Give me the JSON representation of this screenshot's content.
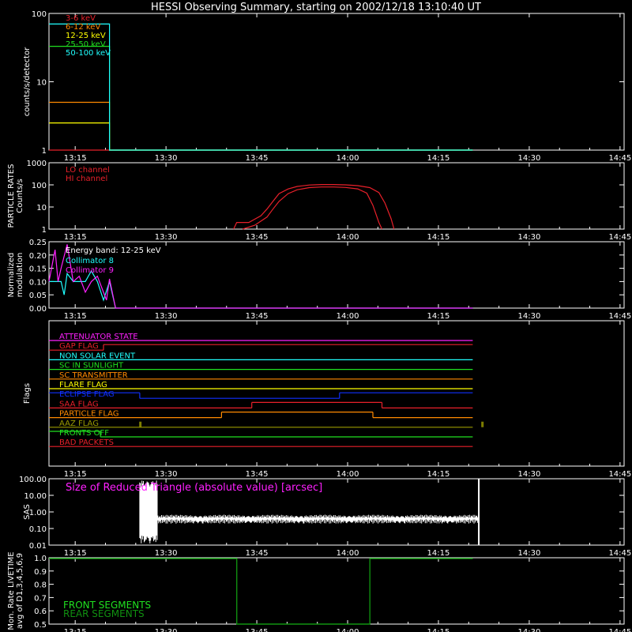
{
  "title": "HESSI Observing Summary, starting on 2002/12/18 13:10:40 UT",
  "colors": {
    "background": "#000000",
    "axes": "#ffffff",
    "red": "#e8202a",
    "orange": "#ff8a00",
    "yellow": "#ffff00",
    "green": "#20e020",
    "cyan": "#20ffff",
    "magenta": "#ff20ff",
    "blue": "#1030ff",
    "olive": "#9a9a00",
    "darkgreen": "#109010",
    "white": "#ffffff"
  },
  "time_ticks": [
    "13:15",
    "13:30",
    "13:45",
    "14:00",
    "14:15",
    "14:30",
    "14:45"
  ],
  "chart_data": [
    {
      "id": "count-rates",
      "type": "line",
      "scale": "log",
      "ylabel": "counts/s/detector",
      "yticks": [
        "1",
        "10",
        "100"
      ],
      "ylim": [
        1,
        100
      ],
      "xlim_min": [
        0,
        70
      ],
      "series": [
        {
          "name": "3-6 keV",
          "color": "red",
          "points": [
            [
              0,
              1
            ],
            [
              70,
              1
            ]
          ]
        },
        {
          "name": "6-12 keV",
          "color": "orange",
          "points": [
            [
              0,
              5
            ],
            [
              10,
              5
            ],
            [
              10,
              1
            ],
            [
              70,
              1
            ]
          ]
        },
        {
          "name": "12-25 keV",
          "color": "yellow",
          "points": [
            [
              0,
              2.5
            ],
            [
              10,
              2.5
            ],
            [
              10,
              1
            ],
            [
              70,
              1
            ]
          ]
        },
        {
          "name": "25-50 keV",
          "color": "green",
          "points": [
            [
              0,
              33
            ],
            [
              10,
              33
            ],
            [
              10,
              1
            ],
            [
              70,
              1
            ]
          ]
        },
        {
          "name": "50-100 keV",
          "color": "cyan",
          "points": [
            [
              0,
              70
            ],
            [
              10,
              70
            ],
            [
              10,
              1
            ],
            [
              70,
              1
            ]
          ]
        }
      ]
    },
    {
      "id": "particle-rates",
      "type": "line",
      "scale": "log",
      "ylabel": "PARTICLE RATES",
      "ylabel2": "Counts/s",
      "yticks": [
        "1",
        "10",
        "100",
        "1000"
      ],
      "ylim": [
        1,
        1000
      ],
      "series": [
        {
          "name": "LO channel",
          "color": "red",
          "points": [
            [
              30.5,
              1
            ],
            [
              31,
              2
            ],
            [
              33,
              2
            ],
            [
              35,
              4
            ],
            [
              36,
              8
            ],
            [
              37,
              18
            ],
            [
              38,
              40
            ],
            [
              39.5,
              65
            ],
            [
              41,
              85
            ],
            [
              43,
              98
            ],
            [
              45,
              103
            ],
            [
              47,
              103
            ],
            [
              49,
              100
            ],
            [
              51,
              92
            ],
            [
              53,
              75
            ],
            [
              54.5,
              45
            ],
            [
              55.5,
              15
            ],
            [
              56.5,
              3
            ],
            [
              57,
              1
            ]
          ]
        },
        {
          "name": "HI channel",
          "color": "red",
          "points": [
            [
              32,
              1
            ],
            [
              34,
              1.5
            ],
            [
              36,
              3.5
            ],
            [
              37,
              8
            ],
            [
              38,
              18
            ],
            [
              39.5,
              40
            ],
            [
              41,
              60
            ],
            [
              43,
              75
            ],
            [
              45,
              80
            ],
            [
              47,
              80
            ],
            [
              49,
              76
            ],
            [
              51,
              66
            ],
            [
              52.5,
              42
            ],
            [
              53.5,
              12
            ],
            [
              54.5,
              2
            ],
            [
              55,
              1
            ]
          ]
        }
      ]
    },
    {
      "id": "modulation",
      "type": "line",
      "ylabel": "Normalized",
      "ylabel2": "modulation",
      "yticks": [
        "0.00",
        "0.05",
        "0.10",
        "0.15",
        "0.20",
        "0.25"
      ],
      "ylim": [
        0,
        0.25
      ],
      "legend_title": "Energy band: 12-25 keV",
      "series": [
        {
          "name": "Collimator 8",
          "color": "cyan",
          "points": [
            [
              0,
              0.1
            ],
            [
              2,
              0.1
            ],
            [
              2.5,
              0.05
            ],
            [
              3,
              0.13
            ],
            [
              4,
              0.1
            ],
            [
              6,
              0.1
            ],
            [
              7,
              0.14
            ],
            [
              8,
              0.1
            ],
            [
              9,
              0.03
            ],
            [
              10,
              0.1
            ],
            [
              11,
              0.0
            ],
            [
              70,
              0.0
            ]
          ]
        },
        {
          "name": "Collimator 9",
          "color": "magenta",
          "points": [
            [
              0,
              0.1
            ],
            [
              1,
              0.22
            ],
            [
              1.5,
              0.1
            ],
            [
              2,
              0.15
            ],
            [
              3,
              0.24
            ],
            [
              4,
              0.1
            ],
            [
              5,
              0.12
            ],
            [
              6,
              0.06
            ],
            [
              7,
              0.1
            ],
            [
              8,
              0.12
            ],
            [
              9.5,
              0.03
            ],
            [
              10,
              0.11
            ],
            [
              11,
              0.0
            ],
            [
              70,
              0.0
            ]
          ]
        }
      ]
    },
    {
      "id": "flags",
      "type": "line",
      "ylabel": "Flags",
      "series": [
        {
          "name": "ATTENUATOR STATE",
          "color": "magenta",
          "segments": [
            [
              0,
              70,
              0
            ]
          ]
        },
        {
          "name": "GAP FLAG",
          "color": "red",
          "segments": [
            [
              0,
              9,
              0
            ],
            [
              9,
              70,
              1
            ]
          ]
        },
        {
          "name": "NON SOLAR EVENT",
          "color": "cyan",
          "segments": [
            [
              0,
              70,
              0
            ]
          ]
        },
        {
          "name": "SC IN SUNLIGHT",
          "color": "green",
          "segments": [
            [
              0,
              70,
              0
            ]
          ]
        },
        {
          "name": "SC TRANSMITTER",
          "color": "orange",
          "segments": [
            [
              0,
              70,
              0
            ]
          ]
        },
        {
          "name": "FLARE FLAG",
          "color": "yellow",
          "segments": [
            [
              0,
              70,
              0
            ]
          ]
        },
        {
          "name": "ECLIPSE FLAG",
          "color": "blue",
          "segments": [
            [
              0,
              15,
              1
            ],
            [
              15,
              48,
              0
            ],
            [
              48,
              70,
              1
            ]
          ]
        },
        {
          "name": "SAA FLAG",
          "color": "red",
          "segments": [
            [
              0,
              33.5,
              0
            ],
            [
              33.5,
              55,
              1
            ],
            [
              55,
              70,
              0
            ]
          ]
        },
        {
          "name": "PARTICLE FLAG",
          "color": "orange",
          "segments": [
            [
              0,
              28.5,
              0
            ],
            [
              28.5,
              53.5,
              1
            ],
            [
              53.5,
              70,
              0
            ]
          ]
        },
        {
          "name": "AAZ FLAG",
          "color": "olive",
          "segments": [
            [
              0,
              70,
              0
            ]
          ],
          "spikes": [
            15,
            71.5
          ]
        },
        {
          "name": "FRONTS OFF",
          "color": "green",
          "segments": [
            [
              0,
              8.5,
              1
            ],
            [
              8.5,
              70,
              0
            ]
          ]
        },
        {
          "name": "BAD PACKETS",
          "color": "red",
          "segments": [
            [
              0,
              70,
              0
            ]
          ]
        }
      ]
    },
    {
      "id": "sas",
      "type": "area",
      "scale": "log",
      "ylabel": "SAS",
      "yticks": [
        "0.01",
        "0.10",
        "1.00",
        "10.00",
        "100.00"
      ],
      "ylim": [
        0.01,
        100
      ],
      "annotation": "Size of Reduced Triangle (absolute value) [arcsec]",
      "span": [
        15,
        71
      ],
      "typical_value": 0.4,
      "spike_start_value": 100
    },
    {
      "id": "livetime",
      "type": "line",
      "ylabel": "Mon. Rate LIVETIME",
      "ylabel2": "avg of D1,3,4,5,6,9",
      "yticks": [
        "0.5",
        "0.6",
        "0.7",
        "0.8",
        "0.9",
        "1.0"
      ],
      "ylim": [
        0.5,
        1.0
      ],
      "series": [
        {
          "name": "FRONT SEGMENTS",
          "color": "green",
          "points": [
            [
              0,
              0.995
            ],
            [
              31,
              0.995
            ],
            [
              31,
              0.5
            ],
            [
              53,
              0.5
            ],
            [
              53,
              0.995
            ],
            [
              70,
              0.995
            ]
          ]
        },
        {
          "name": "REAR SEGMENTS",
          "color": "darkgreen",
          "points": [
            [
              0,
              0.993
            ],
            [
              31,
              0.993
            ],
            [
              31,
              0.5
            ],
            [
              53,
              0.5
            ],
            [
              53,
              0.993
            ],
            [
              70,
              0.993
            ]
          ]
        }
      ]
    }
  ]
}
